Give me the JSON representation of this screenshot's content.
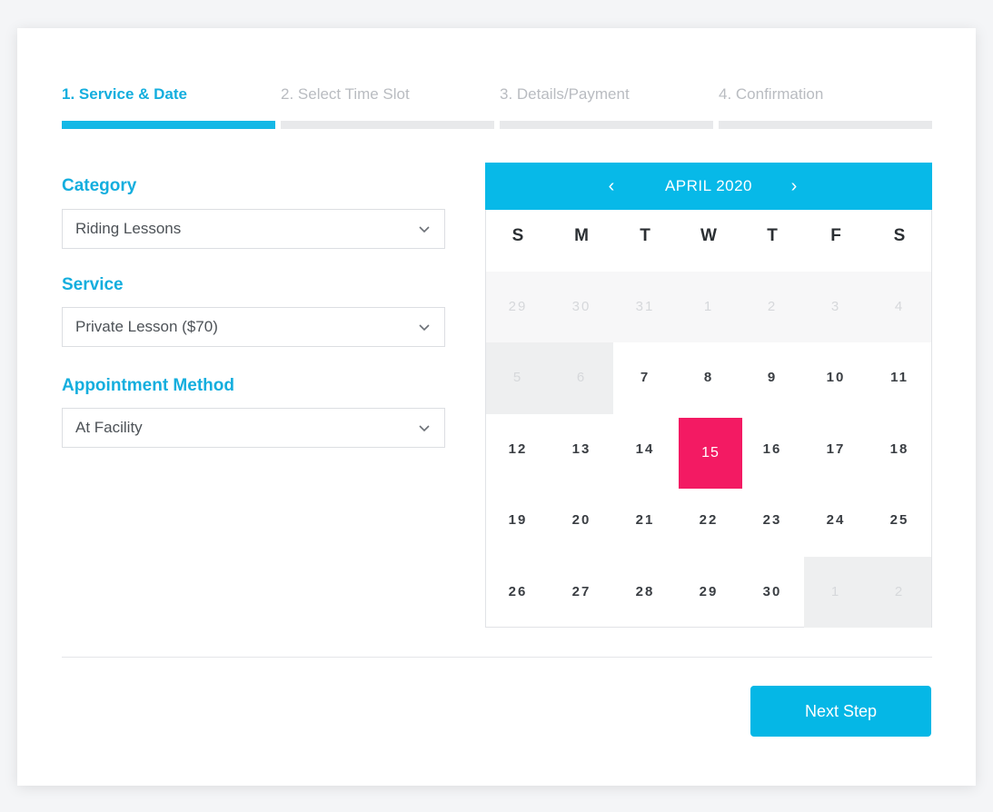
{
  "steps": [
    {
      "label": "1. Service & Date",
      "active": true
    },
    {
      "label": "2. Select Time Slot",
      "active": false
    },
    {
      "label": "3. Details/Payment",
      "active": false
    },
    {
      "label": "4. Confirmation",
      "active": false
    }
  ],
  "form": {
    "category_label": "Category",
    "category_value": "Riding Lessons",
    "service_label": "Service",
    "service_value": "Private Lesson ($70)",
    "method_label": "Appointment Method",
    "method_value": "At Facility"
  },
  "calendar": {
    "title": "APRIL 2020",
    "prev_icon": "‹",
    "next_icon": "›",
    "weekdays": [
      "S",
      "M",
      "T",
      "W",
      "T",
      "F",
      "S"
    ],
    "weeks": [
      [
        {
          "d": "29",
          "s": "muted"
        },
        {
          "d": "30",
          "s": "muted"
        },
        {
          "d": "31",
          "s": "muted"
        },
        {
          "d": "1",
          "s": "muted"
        },
        {
          "d": "2",
          "s": "muted"
        },
        {
          "d": "3",
          "s": "muted"
        },
        {
          "d": "4",
          "s": "muted"
        }
      ],
      [
        {
          "d": "5",
          "s": "blocked"
        },
        {
          "d": "6",
          "s": "blocked"
        },
        {
          "d": "7",
          "s": ""
        },
        {
          "d": "8",
          "s": ""
        },
        {
          "d": "9",
          "s": ""
        },
        {
          "d": "10",
          "s": ""
        },
        {
          "d": "11",
          "s": ""
        }
      ],
      [
        {
          "d": "12",
          "s": ""
        },
        {
          "d": "13",
          "s": ""
        },
        {
          "d": "14",
          "s": ""
        },
        {
          "d": "15",
          "s": "selected"
        },
        {
          "d": "16",
          "s": ""
        },
        {
          "d": "17",
          "s": ""
        },
        {
          "d": "18",
          "s": ""
        }
      ],
      [
        {
          "d": "19",
          "s": ""
        },
        {
          "d": "20",
          "s": ""
        },
        {
          "d": "21",
          "s": ""
        },
        {
          "d": "22",
          "s": ""
        },
        {
          "d": "23",
          "s": ""
        },
        {
          "d": "24",
          "s": ""
        },
        {
          "d": "25",
          "s": ""
        }
      ],
      [
        {
          "d": "26",
          "s": ""
        },
        {
          "d": "27",
          "s": ""
        },
        {
          "d": "28",
          "s": ""
        },
        {
          "d": "29",
          "s": ""
        },
        {
          "d": "30",
          "s": ""
        },
        {
          "d": "1",
          "s": "blocked"
        },
        {
          "d": "2",
          "s": "blocked"
        }
      ]
    ]
  },
  "footer": {
    "next_label": "Next Step"
  },
  "colors": {
    "accent": "#07b9e8",
    "selected": "#f31a63",
    "step_active": "#14aede"
  }
}
